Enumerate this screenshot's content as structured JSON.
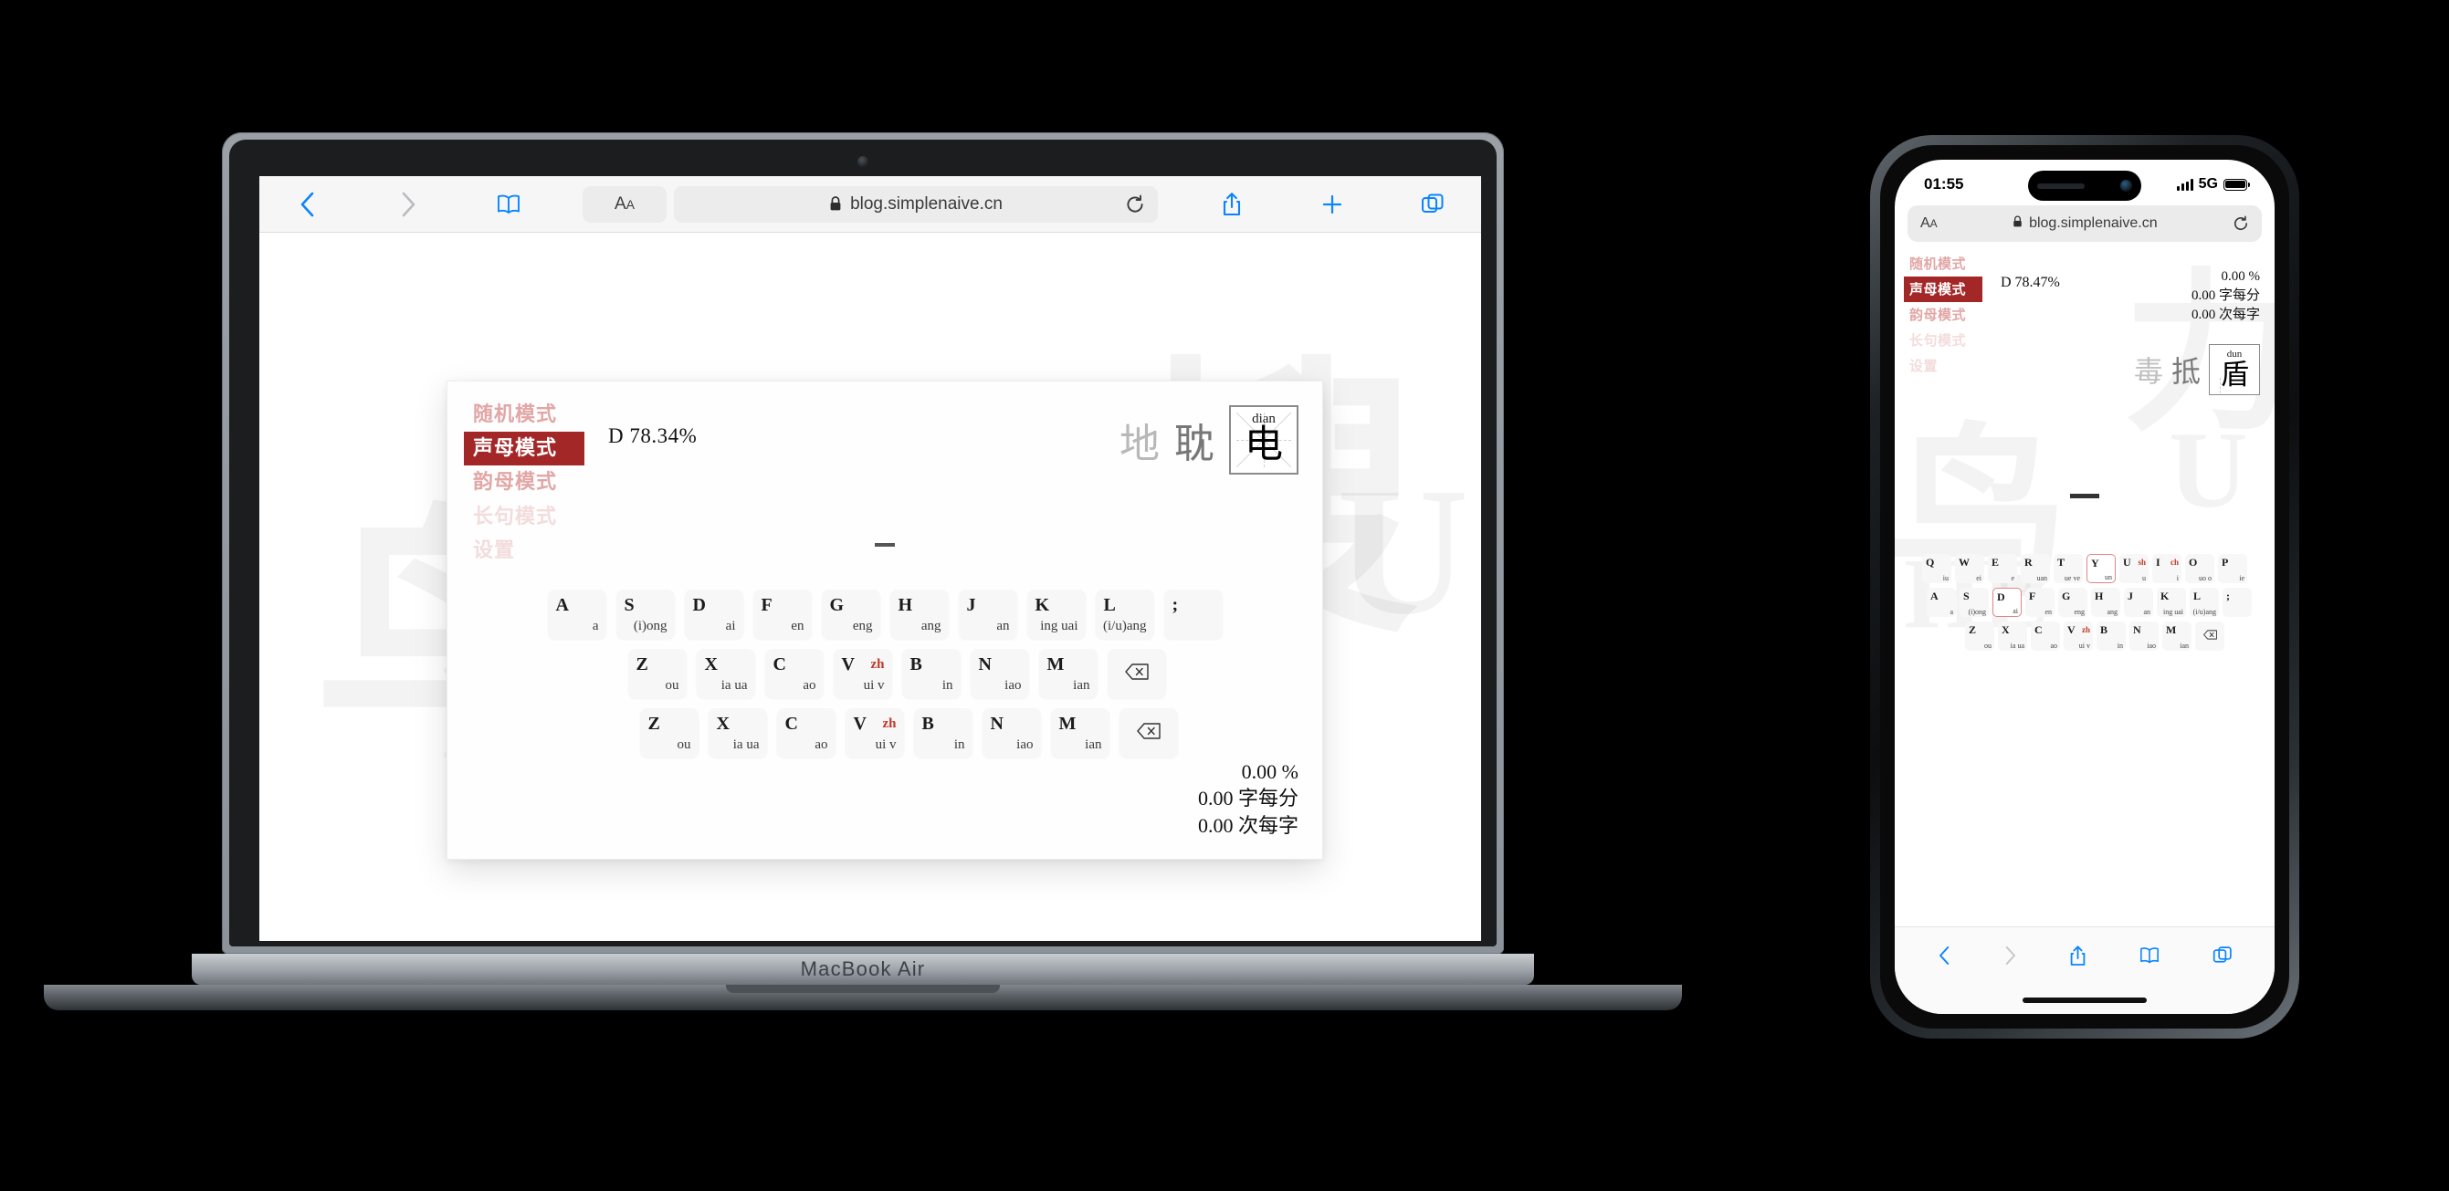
{
  "browser": {
    "url": "blog.simplenaive.cn",
    "lock_icon": "lock-icon",
    "aa_big": "A",
    "aa_small": "A",
    "back_icon": "chevron-left-icon",
    "forward_icon": "chevron-right-icon",
    "bookmarks_icon": "book-icon",
    "reload_icon": "reload-icon",
    "share_icon": "share-icon",
    "newtab_icon": "plus-icon",
    "tabs_icon": "tabs-icon"
  },
  "laptop": {
    "model_label": "MacBook Air"
  },
  "phone": {
    "status": {
      "time": "01:55",
      "network": "5G"
    }
  },
  "app": {
    "modes": [
      {
        "label": "随机模式",
        "state": "normal"
      },
      {
        "label": "声母模式",
        "state": "active"
      },
      {
        "label": "韵母模式",
        "state": "normal"
      },
      {
        "label": "长句模式",
        "state": "faint"
      },
      {
        "label": "设置",
        "state": "faint"
      }
    ],
    "laptop_view": {
      "difficulty": "D 78.34%",
      "stats": [
        "0.00 %",
        "0.00 字每分",
        "0.00 次每字"
      ],
      "chars": {
        "prev2": "地",
        "prev1": "耽",
        "current": "电",
        "pinyin": "dian"
      }
    },
    "phone_view": {
      "difficulty": "D 78.47%",
      "stats": [
        "0.00 %",
        "0.00 字每分",
        "0.00 次每字"
      ],
      "chars": {
        "prev2": "毒",
        "prev1": "抵",
        "current": "盾",
        "pinyin": "dun"
      }
    },
    "keyboard": {
      "backspace_icon": "backspace-icon",
      "rows": [
        [
          {
            "key": "Q",
            "alt": "",
            "sub": "iu"
          },
          {
            "key": "W",
            "alt": "",
            "sub": "ei"
          },
          {
            "key": "E",
            "alt": "",
            "sub": "e"
          },
          {
            "key": "R",
            "alt": "",
            "sub": "uan"
          },
          {
            "key": "T",
            "alt": "",
            "sub": "ue ve"
          },
          {
            "key": "Y",
            "alt": "",
            "sub": "un"
          },
          {
            "key": "U",
            "alt": "sh",
            "sub": "u"
          },
          {
            "key": "I",
            "alt": "ch",
            "sub": "i"
          },
          {
            "key": "O",
            "alt": "",
            "sub": "uo o"
          },
          {
            "key": "P",
            "alt": "",
            "sub": "ie"
          }
        ],
        [
          {
            "key": "A",
            "alt": "",
            "sub": "a"
          },
          {
            "key": "S",
            "alt": "",
            "sub": "(i)ong"
          },
          {
            "key": "D",
            "alt": "",
            "sub": "ai"
          },
          {
            "key": "F",
            "alt": "",
            "sub": "en"
          },
          {
            "key": "G",
            "alt": "",
            "sub": "eng"
          },
          {
            "key": "H",
            "alt": "",
            "sub": "ang"
          },
          {
            "key": "J",
            "alt": "",
            "sub": "an"
          },
          {
            "key": "K",
            "alt": "",
            "sub": "ing uai"
          },
          {
            "key": "L",
            "alt": "",
            "sub": "(i/u)ang"
          },
          {
            "key": ";",
            "alt": "",
            "sub": ""
          }
        ],
        [
          {
            "key": "Z",
            "alt": "",
            "sub": "ou"
          },
          {
            "key": "X",
            "alt": "",
            "sub": "ia ua"
          },
          {
            "key": "C",
            "alt": "",
            "sub": "ao"
          },
          {
            "key": "V",
            "alt": "zh",
            "sub": "ui v"
          },
          {
            "key": "B",
            "alt": "",
            "sub": "in"
          },
          {
            "key": "N",
            "alt": "",
            "sub": "iao"
          },
          {
            "key": "M",
            "alt": "",
            "sub": "ian"
          },
          {
            "key": "⌫",
            "alt": "",
            "sub": ""
          }
        ]
      ],
      "phone_highlighted": [
        "Y",
        "D"
      ]
    },
    "watermarks": {
      "laptop": [
        "HE",
        "鸟",
        "搜",
        "U"
      ],
      "phone": [
        "HE",
        "鸟",
        "力",
        "U"
      ]
    },
    "colors": {
      "accent": "#a42727",
      "mode_text": "#e2a6a6",
      "alt_key": "#c0392b"
    }
  }
}
